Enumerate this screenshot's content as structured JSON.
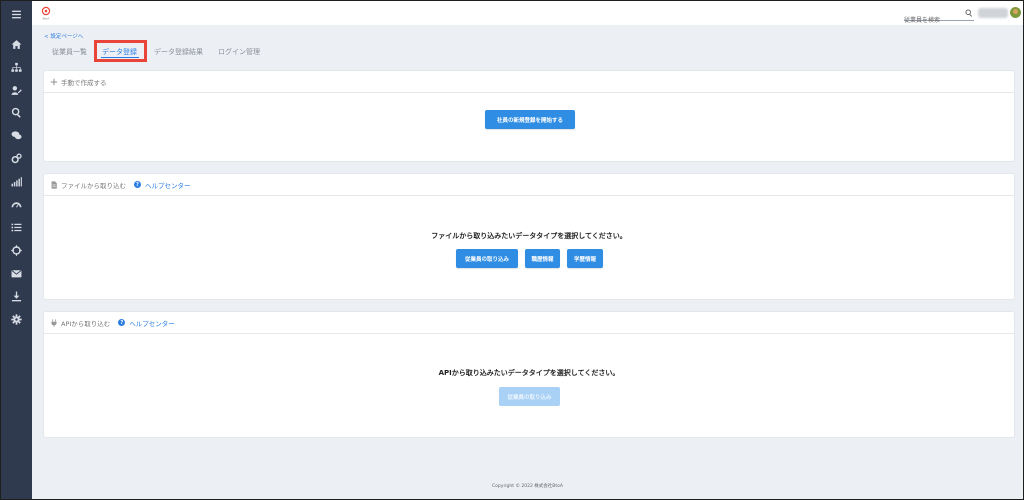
{
  "sidebar": {
    "items": [
      {
        "icon": "menu-icon"
      },
      {
        "icon": "home-icon"
      },
      {
        "icon": "org-chart-icon"
      },
      {
        "icon": "user-edit-icon"
      },
      {
        "icon": "search-icon"
      },
      {
        "icon": "chat-icon"
      },
      {
        "icon": "gears-icon"
      },
      {
        "icon": "bar-chart-icon"
      },
      {
        "icon": "dashboard-icon"
      },
      {
        "icon": "list-icon"
      },
      {
        "icon": "crosshair-icon"
      },
      {
        "icon": "mail-icon"
      },
      {
        "icon": "download-icon"
      },
      {
        "icon": "settings-icon"
      }
    ]
  },
  "header": {
    "logo_text": "BtoA",
    "search_placeholder": "従業員を検索"
  },
  "subnav": {
    "back_label": "< 設定ページへ",
    "tabs": [
      {
        "label": "従業員一覧"
      },
      {
        "label": "データ登録"
      },
      {
        "label": "データ登録結果"
      },
      {
        "label": "ログイン管理"
      }
    ],
    "active_tab": "データ登録"
  },
  "manual": {
    "title": "手動で作成する",
    "button_label": "社員の新規登録を開始する"
  },
  "file_import": {
    "title": "ファイルから取り込む",
    "help_label": "ヘルプセンター",
    "prompt": "ファイルから取り込みたいデータタイプを選択してください。",
    "buttons": [
      "従業員の取り込み",
      "職歴情報",
      "学歴情報"
    ]
  },
  "api_import": {
    "title": "APIから取り込む",
    "help_label": "ヘルプセンター",
    "prompt": "APIから取り込みたいデータタイプを選択してください。",
    "button_label": "従業員の取り込み"
  },
  "footer": {
    "copyright": "Copyright © 2022 株式会社BtoA"
  },
  "colors": {
    "accent": "#2a7de1",
    "button": "#2f8de4",
    "sidebar": "#2f3a4f",
    "highlight": "#e8443a"
  }
}
